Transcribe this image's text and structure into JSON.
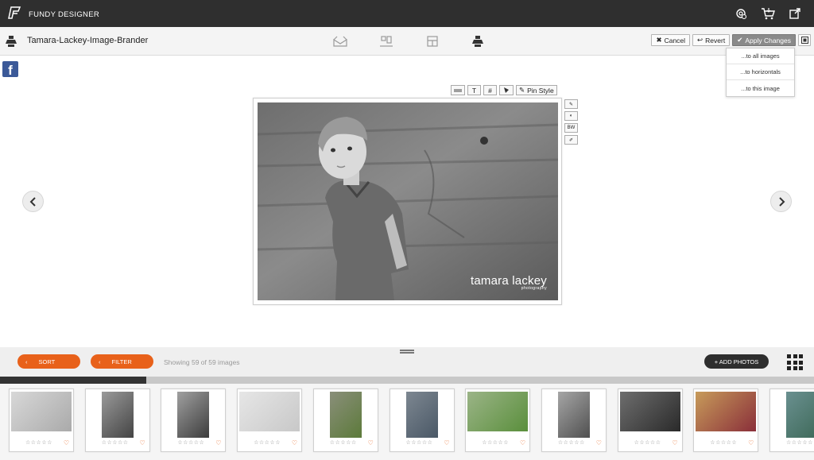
{
  "app": {
    "name": "FUNDY DESIGNER"
  },
  "project": {
    "title": "Tamara-Lackey-Image-Brander"
  },
  "toolbar": {
    "cancel_label": "Cancel",
    "revert_label": "Revert",
    "apply_label": "Apply Changes"
  },
  "apply_menu": {
    "items": [
      "...to all images",
      "...to horizontals",
      "...to this image"
    ]
  },
  "style_tools": {
    "pin_style_label": "Pin Style",
    "text_glyph": "T",
    "hash_glyph": "#",
    "bw_label": "BW"
  },
  "watermark": {
    "name": "tamara lackey",
    "sub": "photography"
  },
  "bottom": {
    "sort_label": "SORT",
    "filter_label": "FILTER",
    "showing_text": "Showing 59 of 59 images",
    "add_photos_label": "+ ADD PHOTOS"
  },
  "thumbnail_rating": "☆☆☆☆☆",
  "progress": {
    "fraction": 0.18
  },
  "icons": [
    "fundy-logo-icon",
    "settings-icon",
    "cart-icon",
    "external-link-icon",
    "brander-icon",
    "facebook-icon"
  ],
  "colors": {
    "accent": "#e8611a",
    "topbar": "#2f2f2f",
    "facebook": "#3b5998"
  }
}
